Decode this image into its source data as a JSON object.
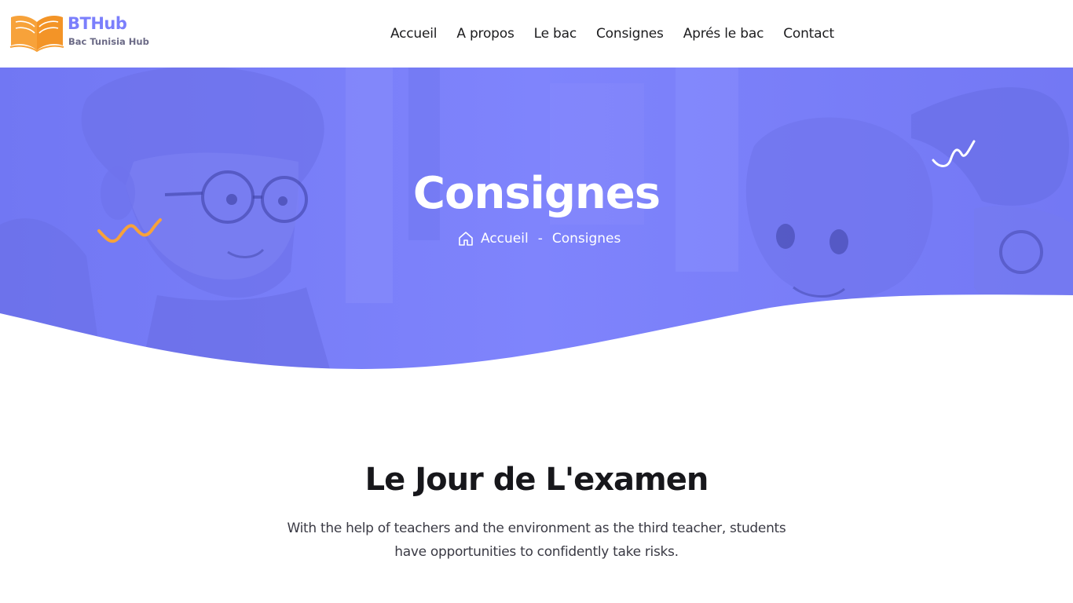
{
  "brand": {
    "name": "BTHub",
    "tagline": "Bac Tunisia Hub",
    "primary_color": "#7b80fb",
    "accent_color": "#f7a23a"
  },
  "nav": {
    "items": [
      {
        "label": "Accueil"
      },
      {
        "label": "A propos"
      },
      {
        "label": "Le bac"
      },
      {
        "label": "Consignes"
      },
      {
        "label": "Aprés le bac"
      },
      {
        "label": "Contact"
      }
    ]
  },
  "hero": {
    "title": "Consignes",
    "breadcrumb": {
      "home_icon": "home-icon",
      "home_label": "Accueil",
      "separator": "-",
      "current": "Consignes"
    }
  },
  "section": {
    "title": "Le Jour de L'examen",
    "text": "With the help of teachers and the environment as the third teacher, students have opportunities to confidently take risks."
  }
}
